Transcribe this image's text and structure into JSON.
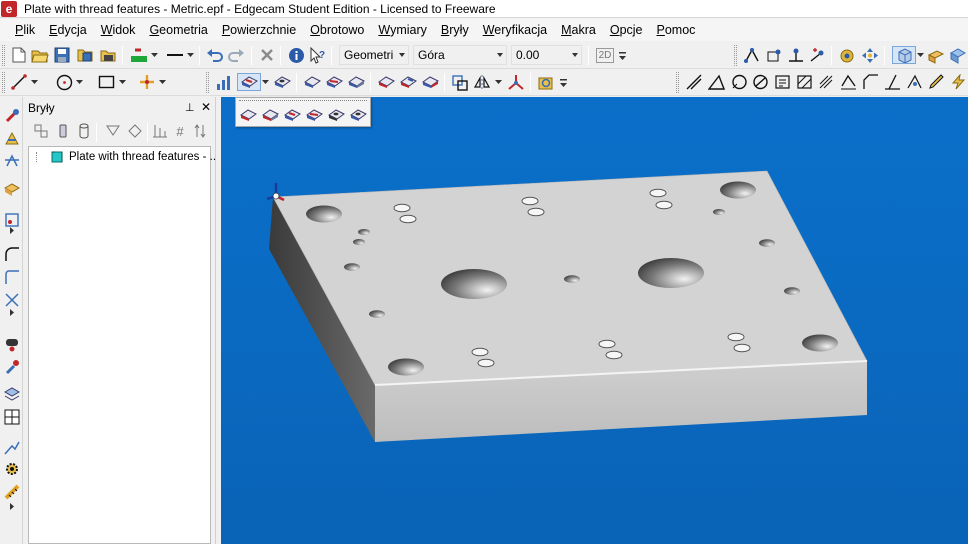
{
  "window": {
    "app_icon_letter": "e",
    "title": "Plate with thread features - Metric.epf - Edgecam Student Edition - Licensed to Freeware"
  },
  "menubar": {
    "items": [
      {
        "first": "P",
        "rest": "lik"
      },
      {
        "first": "E",
        "rest": "dycja"
      },
      {
        "first": "W",
        "rest": "idok"
      },
      {
        "first": "G",
        "rest": "eometria"
      },
      {
        "first": "P",
        "rest": "owierzchnie"
      },
      {
        "first": "O",
        "rest": "brotowo"
      },
      {
        "first": "W",
        "rest": "ymiary"
      },
      {
        "first": "B",
        "rest": "ryły"
      },
      {
        "first": "W",
        "rest": "eryfikacja"
      },
      {
        "first": "M",
        "rest": "akra"
      },
      {
        "first": "O",
        "rest": "pcje"
      },
      {
        "first": "P",
        "rest": "omoc"
      }
    ]
  },
  "toolbar": {
    "layer_combo": "Geometri",
    "view_combo": "Góra",
    "depth_combo": "0.00",
    "mode_2d": "2D"
  },
  "panel": {
    "title": "Bryły",
    "pin_glyph": "⊥",
    "close_glyph": "✕",
    "hash_glyph": "#",
    "tree_item_label": "Plate with thread features - ..."
  },
  "colors": {
    "viewport_bg": "#0b6fc9",
    "plate_top": "#d4d4d4",
    "plate_front": "#c0c0c0",
    "plate_side": "#5f5f5f",
    "accent_red": "#c0262a"
  }
}
